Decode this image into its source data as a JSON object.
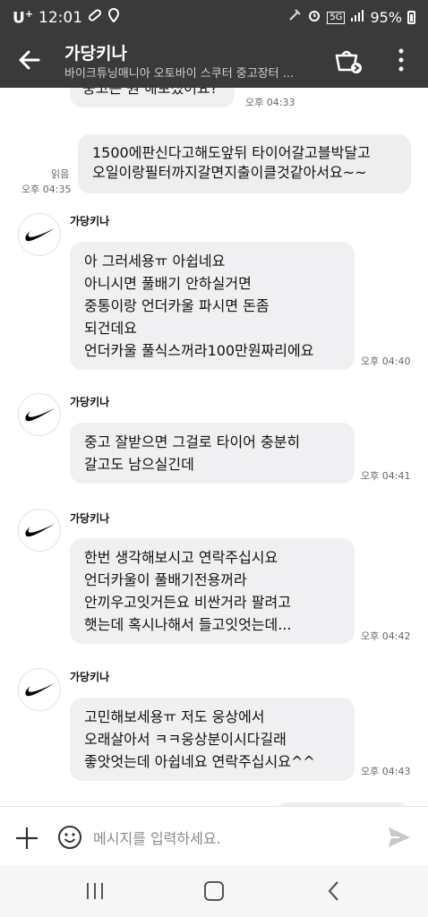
{
  "status_bar": {
    "carrier": "U",
    "carrier_sup": "+",
    "time": "12:01",
    "network": "5G",
    "battery": "95%"
  },
  "header": {
    "title": "가당키나",
    "subtitle": "바이크튜닝매니아 오토바이 스쿠터 중고장터 ..."
  },
  "messages": {
    "m0": {
      "text": "중고는 원 해보셨어요?",
      "time": "오후 04:33"
    },
    "m1": {
      "lines": [
        "1500에판신다고해도앞뒤 타이어갈고블박달고",
        "오일이랑필터까지갈면지출이클것같아서요~~"
      ],
      "read": "읽음",
      "time": "오후 04:35"
    },
    "m2": {
      "sender": "가당키나",
      "lines": [
        "아 그러세용ㅠ 아쉽네요",
        "아니시면 풀배기 안하실거면",
        "중통이랑 언더카울 파시면 돈좀",
        "되건데요",
        "언더카울 풀식스꺼라100만원짜리에요"
      ],
      "time": "오후 04:40"
    },
    "m3": {
      "sender": "가당키나",
      "lines": [
        "중고 잘받으면 그걸로 타이어 충분히",
        "갈고도 남으실긴데"
      ],
      "time": "오후 04:41"
    },
    "m4": {
      "sender": "가당키나",
      "lines": [
        "한번 생각해보시고 연락주십시요",
        "언더카울이 풀배기전용꺼라",
        "안끼우고잇거든요 비싼거라 팔려고",
        "햇는데 혹시나해서 들고잇엇는데..."
      ],
      "time": "오후 04:42"
    },
    "m5": {
      "sender": "가당키나",
      "lines": [
        "고민해보세용ㅠ 저도 웅상에서",
        "오래살아서 ㅋㅋ웅상분이시다길래",
        "좋앗엇는데 아쉽네요 연락주십시요^^"
      ],
      "time": "오후 04:43"
    }
  },
  "input": {
    "placeholder": "메시지를 입력하세요."
  },
  "icons": {
    "back": "arrow-left-icon",
    "cart": "shopping-basket-icon",
    "more": "more-vertical-icon",
    "avatar": "nike-swoosh-icon",
    "plus": "plus-icon",
    "emoji": "emoji-icon",
    "send": "send-icon"
  },
  "colors": {
    "header_bg": "#3a3a3a",
    "bubble_me": "#eeeeee",
    "bubble_other": "#f0f0f2"
  }
}
